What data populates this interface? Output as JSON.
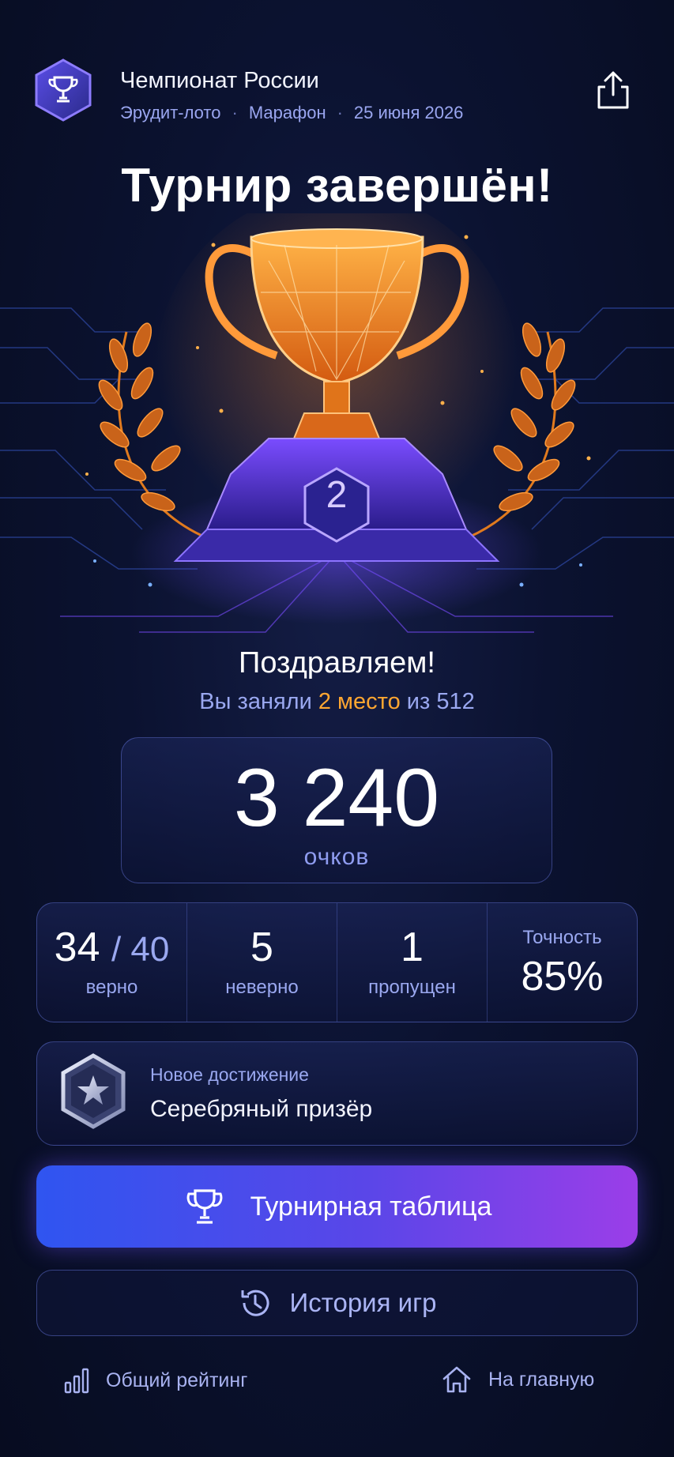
{
  "header": {
    "title": "Чемпионат России",
    "meta": [
      "Эрудит-лото",
      "Марафон",
      "25 июня 2026"
    ],
    "separator": "·",
    "logo_icon": "trophy-hexagon-icon",
    "share_icon": "share-icon"
  },
  "main_title": "Турнир завершён!",
  "hero": {
    "place_number": "2",
    "illustration": "glowing-trophy-with-laurels"
  },
  "congrats": "Поздравляем!",
  "place_line": {
    "prefix": "Вы заняли",
    "place": "2 место",
    "suffix": "из 512"
  },
  "score": {
    "value": "3 240",
    "unit": "очков"
  },
  "stats": {
    "correct": "34",
    "total": "/ 40",
    "correct_label": "верно",
    "wrong": "5",
    "wrong_label": "неверно",
    "skipped": "1",
    "skipped_label": "пропущен",
    "accuracy_label": "Точность",
    "accuracy": "85%"
  },
  "achievement": {
    "label": "Новое достижение",
    "title": "Серебряный призёр",
    "icon": "silver-star-badge-icon"
  },
  "buttons": {
    "leaderboard": "Турнирная таблица",
    "history": "История игр"
  },
  "footer": {
    "rating": "Общий рейтинг",
    "home": "На главную"
  },
  "colors": {
    "accent_orange": "#ffa631",
    "accent_blue": "#2f55f0",
    "accent_purple": "#9b3ee8",
    "muted_text": "#9aa8f0"
  }
}
